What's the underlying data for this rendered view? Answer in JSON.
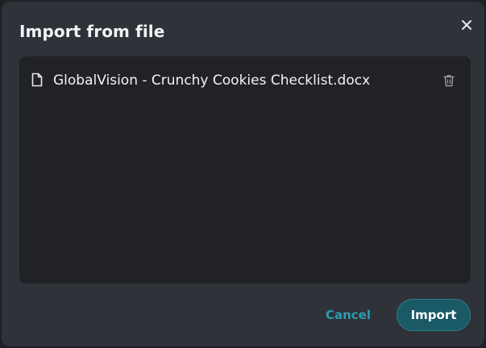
{
  "dialog": {
    "title": "Import from file",
    "close_icon": "close-icon"
  },
  "files": [
    {
      "name": "GlobalVision - Crunchy Cookies Checklist.docx",
      "icon": "document-icon",
      "remove_icon": "trash-icon"
    }
  ],
  "actions": {
    "cancel_label": "Cancel",
    "import_label": "Import"
  },
  "colors": {
    "background": "#2f3239",
    "panel": "#212226",
    "accent": "#2a9cb0",
    "primary_button": "#1a5966",
    "text": "#f2f3f5"
  }
}
